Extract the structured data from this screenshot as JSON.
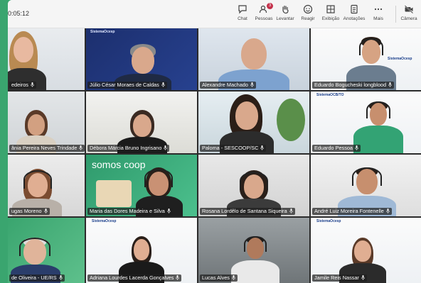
{
  "toolbar": {
    "timer": "0:05:12",
    "chat": "Chat",
    "people": "Pessoas",
    "people_badge": "3",
    "raise": "Levantar",
    "react": "Reagir",
    "view": "Exibição",
    "notes": "Anotações",
    "more": "Mais",
    "camera": "Câmera"
  },
  "participants": [
    {
      "name": "edeiros"
    },
    {
      "name": "Júlio César Moraes de Caldas"
    },
    {
      "name": "Alexandre Machado"
    },
    {
      "name": "Eduardo Bogucheski longblood"
    },
    {
      "name": "ânia Pereira Neves Trindade"
    },
    {
      "name": "Débora Márcia Bruno Ingrisano"
    },
    {
      "name": "Paloma - SESCOOP/SC"
    },
    {
      "name": "Eduardo Pessoa"
    },
    {
      "name": "ugas Moreno"
    },
    {
      "name": "Maria das Dores Madeira e Silva"
    },
    {
      "name": "Rosana Lordêlo de Santana Siqueira"
    },
    {
      "name": "André Luiz Moreira Fontenelle"
    },
    {
      "name": "de Oliveira - UE/RS"
    },
    {
      "name": "Adriana Lourdes Lacerda Gonçalves"
    },
    {
      "name": "Lucas Alves"
    },
    {
      "name": "Jamile Reis Nassar"
    }
  ],
  "logos": {
    "sistema": "SistemaOcesp",
    "sistema_ocb": "SistemaOCB/TO",
    "somos_coop": "somos coop"
  }
}
